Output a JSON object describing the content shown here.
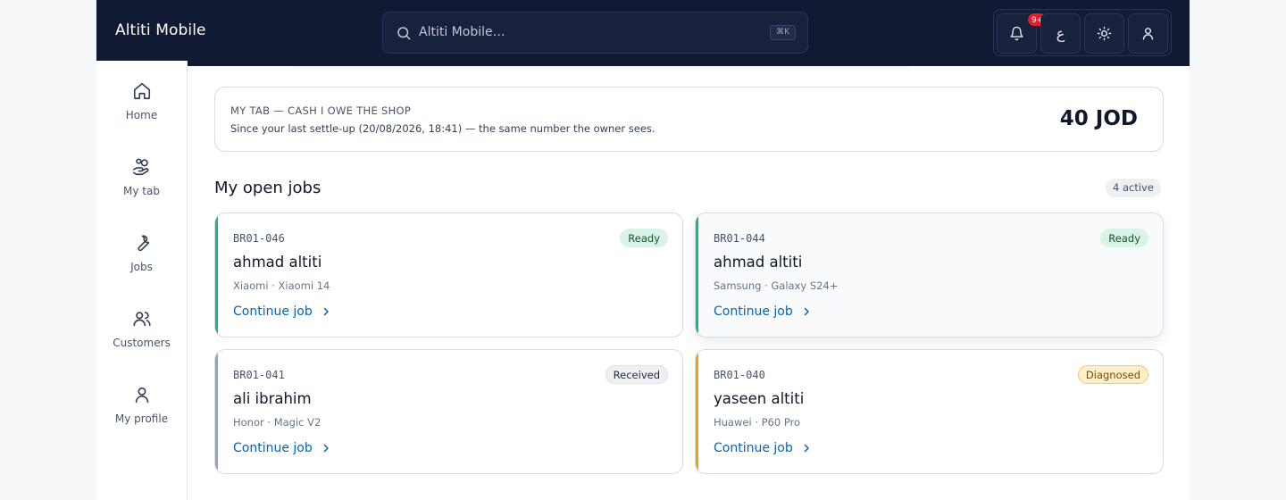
{
  "header": {
    "brand": "Altiti Mobile",
    "search_placeholder": "Altiti Mobile…",
    "search_shortcut": "⌘K",
    "notifications_badge": "9+",
    "language_label": "ع",
    "icons": [
      "bell-icon",
      "sun-icon",
      "user-icon"
    ]
  },
  "sidebar": {
    "items": [
      {
        "label": "Home",
        "icon": "home-icon"
      },
      {
        "label": "My tab",
        "icon": "hand-coins-icon"
      },
      {
        "label": "Jobs",
        "icon": "wrench-icon"
      },
      {
        "label": "Customers",
        "icon": "users-icon"
      },
      {
        "label": "My profile",
        "icon": "user-icon"
      }
    ]
  },
  "tab_summary": {
    "title": "MY TAB — CASH I OWE THE SHOP",
    "subtitle": "Since your last settle-up (20/08/2026, 18:41) — the same number the owner sees.",
    "amount": "40 JOD"
  },
  "open_jobs": {
    "title": "My open jobs",
    "count_label": "4 active",
    "action_label": "Continue job",
    "items": [
      {
        "code": "BR01-046",
        "status": "Ready",
        "customer": "ahmad altiti",
        "device": "Xiaomi · Xiaomi 14",
        "accent": "#12b981"
      },
      {
        "code": "BR01-044",
        "status": "Ready",
        "customer": "ahmad altiti",
        "device": "Samsung · Galaxy S24+",
        "accent": "#12b981"
      },
      {
        "code": "BR01-041",
        "status": "Received",
        "customer": "ali ibrahim",
        "device": "Honor · Magic V2",
        "accent": "#94a3b8"
      },
      {
        "code": "BR01-040",
        "status": "Diagnosed",
        "customer": "yaseen altiti",
        "device": "Huawei · P60 Pro",
        "accent": "#f59e0b"
      }
    ]
  },
  "colors": {
    "header_bg": "#111a33",
    "link": "#0a62b3",
    "badge": "#e11d2e"
  }
}
